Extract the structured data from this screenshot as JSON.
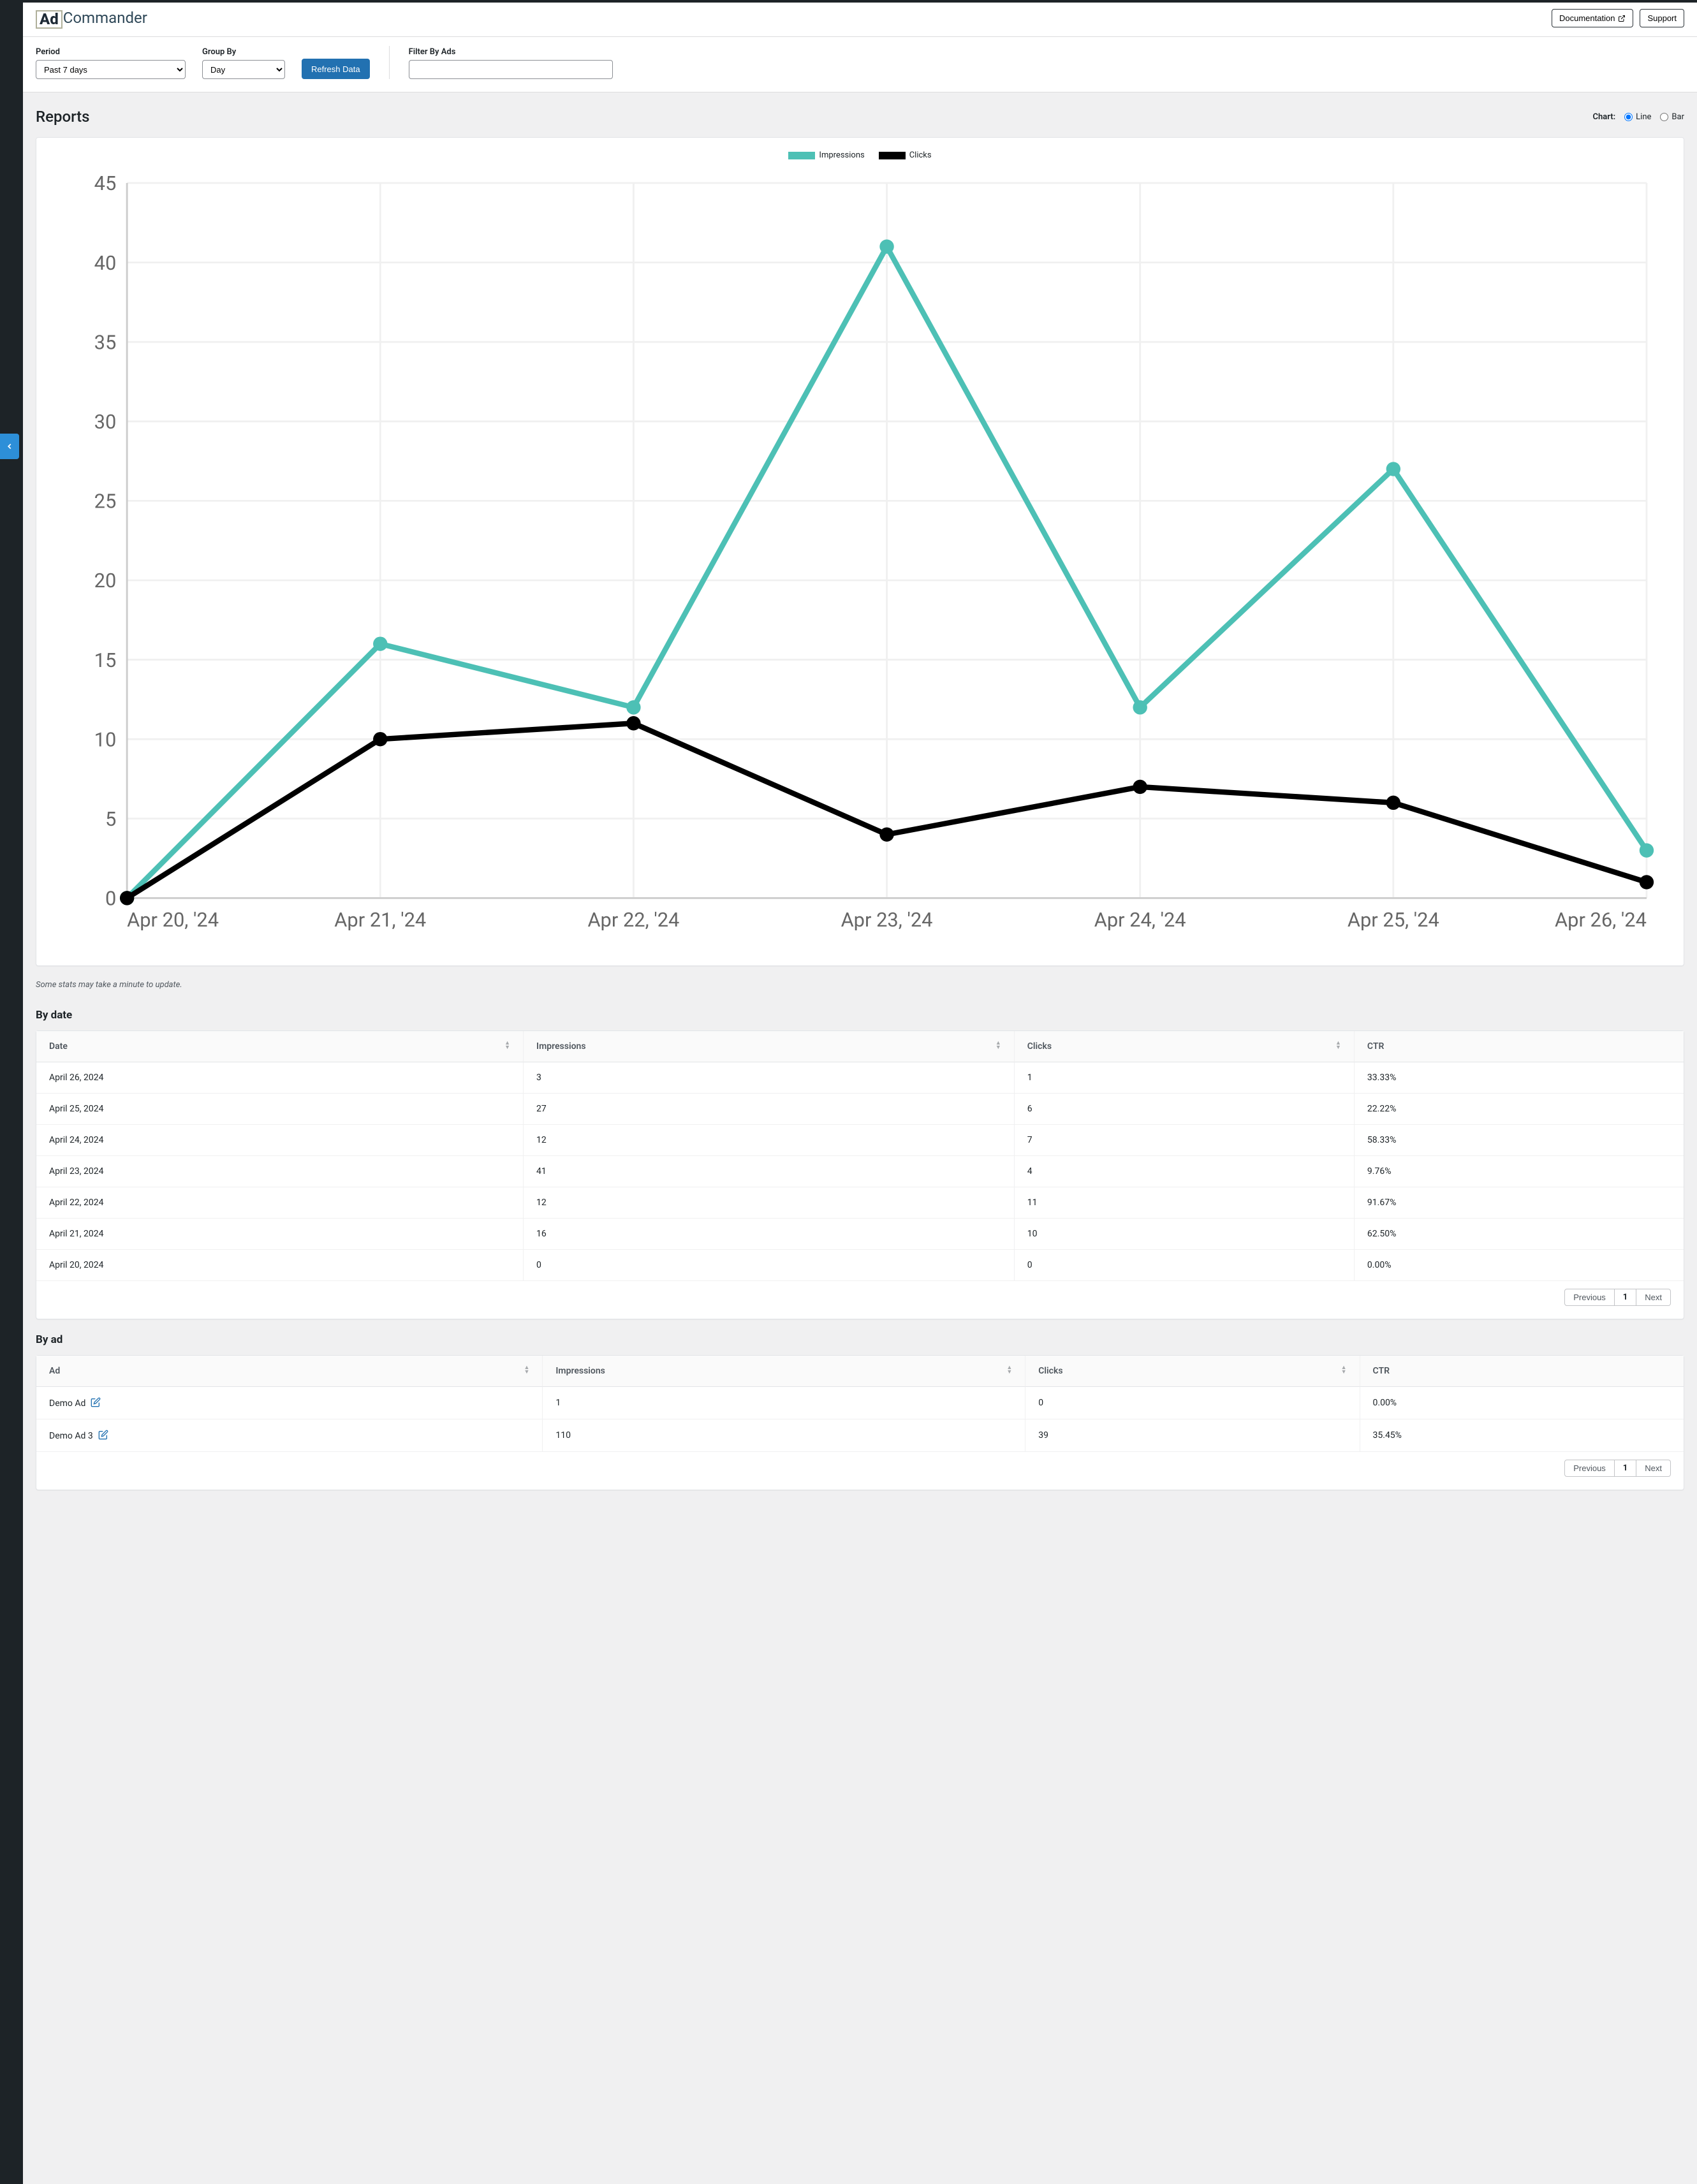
{
  "logo": {
    "bold": "Ad",
    "rest": "Commander"
  },
  "topbar": {
    "doc_label": "Documentation",
    "support_label": "Support"
  },
  "filters": {
    "period_label": "Period",
    "period_value": "Past 7 days",
    "group_label": "Group By",
    "group_value": "Day",
    "refresh_label": "Refresh Data",
    "filter_ads_label": "Filter By Ads"
  },
  "page_title": "Reports",
  "chart_switch": {
    "label": "Chart:",
    "line": "Line",
    "bar": "Bar",
    "selected": "line"
  },
  "legend": {
    "impressions": "Impressions",
    "clicks": "Clicks"
  },
  "note": "Some stats may take a minute to update.",
  "by_date": {
    "title": "By date",
    "cols": [
      "Date",
      "Impressions",
      "Clicks",
      "CTR"
    ],
    "rows": [
      {
        "c0": "April 26, 2024",
        "c1": "3",
        "c2": "1",
        "c3": "33.33%"
      },
      {
        "c0": "April 25, 2024",
        "c1": "27",
        "c2": "6",
        "c3": "22.22%"
      },
      {
        "c0": "April 24, 2024",
        "c1": "12",
        "c2": "7",
        "c3": "58.33%"
      },
      {
        "c0": "April 23, 2024",
        "c1": "41",
        "c2": "4",
        "c3": "9.76%"
      },
      {
        "c0": "April 22, 2024",
        "c1": "12",
        "c2": "11",
        "c3": "91.67%"
      },
      {
        "c0": "April 21, 2024",
        "c1": "16",
        "c2": "10",
        "c3": "62.50%"
      },
      {
        "c0": "April 20, 2024",
        "c1": "0",
        "c2": "0",
        "c3": "0.00%"
      }
    ]
  },
  "by_ad": {
    "title": "By ad",
    "cols": [
      "Ad",
      "Impressions",
      "Clicks",
      "CTR"
    ],
    "rows": [
      {
        "c0": "Demo Ad",
        "c1": "1",
        "c2": "0",
        "c3": "0.00%"
      },
      {
        "c0": "Demo Ad 3",
        "c1": "110",
        "c2": "39",
        "c3": "35.45%"
      }
    ]
  },
  "pager": {
    "prev": "Previous",
    "page": "1",
    "next": "Next"
  },
  "chart_data": {
    "type": "line",
    "x_labels": [
      "Apr 20, '24",
      "Apr 21, '24",
      "Apr 22, '24",
      "Apr 23, '24",
      "Apr 24, '24",
      "Apr 25, '24",
      "Apr 26, '24"
    ],
    "y_ticks": [
      0,
      5,
      10,
      15,
      20,
      25,
      30,
      35,
      40,
      45
    ],
    "ylim": [
      0,
      45
    ],
    "series": [
      {
        "name": "Impressions",
        "color": "#4dc0b5",
        "values": [
          0,
          16,
          12,
          41,
          12,
          27,
          3
        ]
      },
      {
        "name": "Clicks",
        "color": "#000000",
        "values": [
          0,
          10,
          11,
          4,
          7,
          6,
          1
        ]
      }
    ]
  }
}
